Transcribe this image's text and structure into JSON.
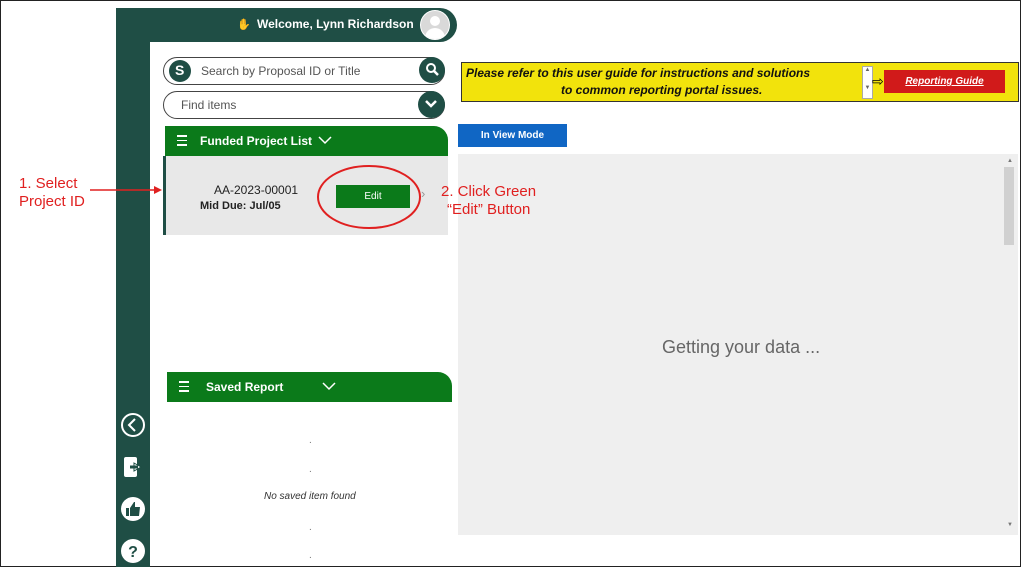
{
  "header": {
    "welcome": "Welcome, Lynn Richardson"
  },
  "search": {
    "placeholder": "Search by Proposal ID or Title"
  },
  "find": {
    "placeholder": "Find items"
  },
  "funded_list": {
    "title": "Funded Project List"
  },
  "project": {
    "id": "AA-2023-00001",
    "due": "Mid Due: Jul/05",
    "edit_label": "Edit"
  },
  "saved": {
    "title": "Saved Report",
    "empty_text": "No saved item found",
    "dots": [
      ".",
      ".",
      ".",
      "."
    ]
  },
  "notice": {
    "line1": "Please refer to this user guide for instructions and solutions",
    "line2": "to common reporting portal issues.",
    "guide_button": "Reporting Guide"
  },
  "main": {
    "mode_button": "In View Mode",
    "loading_text": "Getting your data ..."
  },
  "annotations": {
    "step1_line1": "1. Select",
    "step1_line2": "Project ID",
    "step2_line1": "2. Click Green",
    "step2_line2": "“Edit” Button"
  },
  "colors": {
    "rail": "#1f4e45",
    "green": "#0b7a1a",
    "blue": "#1066c4",
    "yellow": "#f2e30c",
    "red": "#d11a1a"
  }
}
